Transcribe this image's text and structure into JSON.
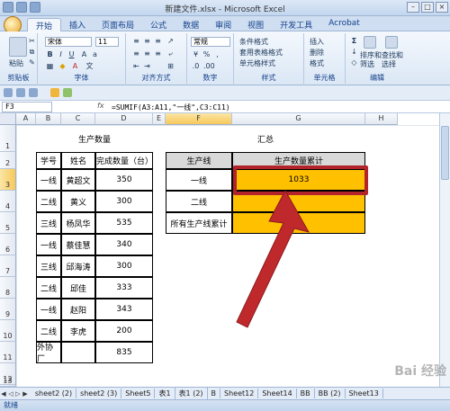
{
  "window": {
    "title": "新建文件.xlsx - Microsoft Excel"
  },
  "ribbon_tabs": [
    "开始",
    "插入",
    "页面布局",
    "公式",
    "数据",
    "审阅",
    "视图",
    "开发工具",
    "Acrobat"
  ],
  "ribbon": {
    "paste": "粘贴",
    "font_name": "宋体",
    "font_size": "11",
    "number_format": "常规",
    "cond_format": "条件格式",
    "table_format": "套用表格格式",
    "cell_style": "单元格样式",
    "insert": "插入",
    "delete": "删除",
    "format": "格式",
    "sort_filter": "排序和\n筛选",
    "find_select": "查找和\n选择",
    "groups": [
      "剪贴板",
      "字体",
      "对齐方式",
      "数字",
      "样式",
      "单元格",
      "编辑"
    ]
  },
  "formula_bar": {
    "name_box": "F3",
    "fx": "fx",
    "formula": "=SUMIF(A3:A11,\"一线\",C3:C11)"
  },
  "columns": [
    "A",
    "B",
    "C",
    "D",
    "E",
    "F",
    "G",
    "H"
  ],
  "rows": [
    "1",
    "2",
    "3",
    "4",
    "5",
    "6",
    "7",
    "8",
    "9",
    "10",
    "11",
    "12",
    "13"
  ],
  "left_table": {
    "title": "生产数量",
    "headers": [
      "学号",
      "姓名",
      "完成数量（台）"
    ],
    "rows": [
      [
        "一线",
        "黄超文",
        "350"
      ],
      [
        "二线",
        "黄义",
        "300"
      ],
      [
        "三线",
        "杨凤华",
        "535"
      ],
      [
        "一线",
        "蔡佳慧",
        "340"
      ],
      [
        "三线",
        "邱海涛",
        "300"
      ],
      [
        "二线",
        "邱佳",
        "333"
      ],
      [
        "一线",
        "赵阳",
        "343"
      ],
      [
        "二线",
        "李虎",
        "200"
      ],
      [
        "外协厂",
        "",
        "835"
      ]
    ]
  },
  "right_table": {
    "title": "汇总",
    "headers": [
      "生产线",
      "生产数量累计"
    ],
    "rows": [
      [
        "一线",
        "1033"
      ],
      [
        "二线",
        ""
      ],
      [
        "所有生产线累计",
        ""
      ]
    ]
  },
  "sheet_tabs": [
    "sheet2 (2)",
    "sheet2 (3)",
    "Sheet5",
    "表1",
    "表1 (2)",
    "B",
    "Sheet12",
    "Sheet14",
    "BB",
    "BB (2)",
    "Sheet13"
  ],
  "status": "就绪",
  "watermark": "Bai 经验",
  "colors": {
    "highlight": "#ffc000",
    "arrow": "#c0292b",
    "header_fill": "#d9d9d9"
  }
}
